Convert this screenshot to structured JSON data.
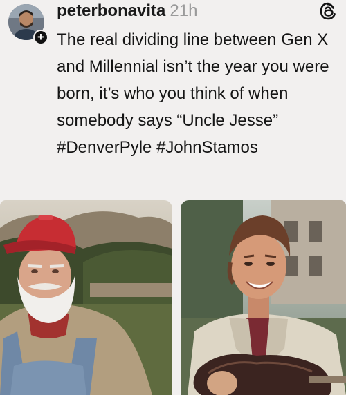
{
  "post": {
    "author": {
      "username": "peterbonavita",
      "timestamp": "21h",
      "avatar_icon": "profile-photo",
      "follow_symbol": "+"
    },
    "platform_icon": "threads-logo-icon",
    "text": {
      "body": "The real dividing line between Gen X and Millennial isn’t the year you were born, it’s who you think of when somebody says “Uncle Jesse”",
      "hashtags": [
        "#DenverPyle",
        "#JohnStamos"
      ]
    },
    "media": [
      {
        "description_icon": "photo-older-man-red-cap-overalls"
      },
      {
        "description_icon": "photo-young-man-guitar"
      }
    ]
  },
  "colors": {
    "background": "#f2f0ef",
    "text": "#151515",
    "muted": "#9a9a9a"
  }
}
